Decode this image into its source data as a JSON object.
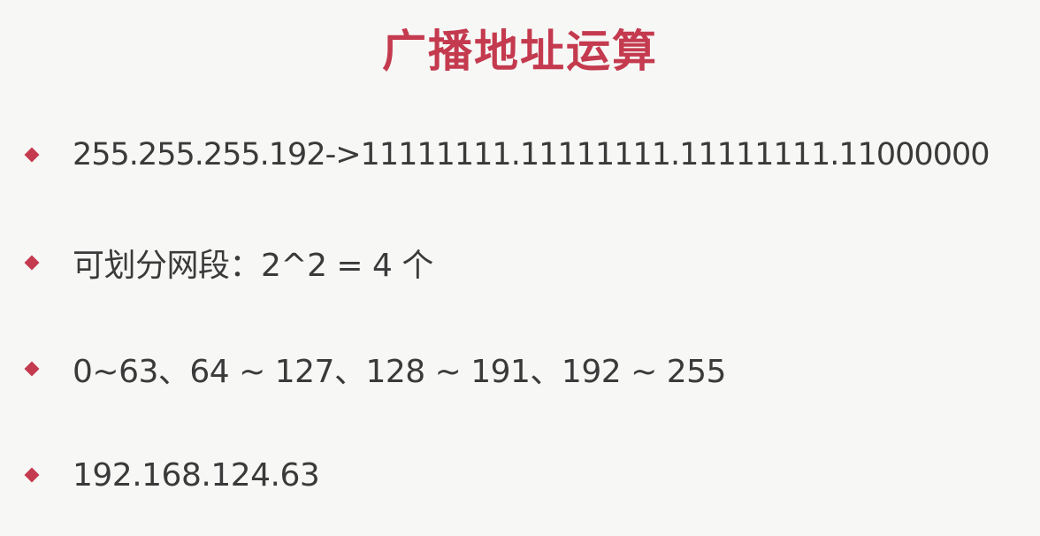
{
  "title": "广播地址运算",
  "colors": {
    "accent": "#c43a4e",
    "text": "#3a3a3a",
    "background": "#f7f7f6"
  },
  "bullets": [
    {
      "icon": "diamond-bullet",
      "text": "255.255.255.192->11111111.11111111.11111111.11000000"
    },
    {
      "icon": "diamond-bullet",
      "text": "可划分网段：2^2 = 4 个"
    },
    {
      "icon": "diamond-bullet",
      "text": "0~63、64 ~ 127、128 ~ 191、192 ~ 255"
    },
    {
      "icon": "diamond-bullet",
      "text": "192.168.124.63"
    }
  ]
}
